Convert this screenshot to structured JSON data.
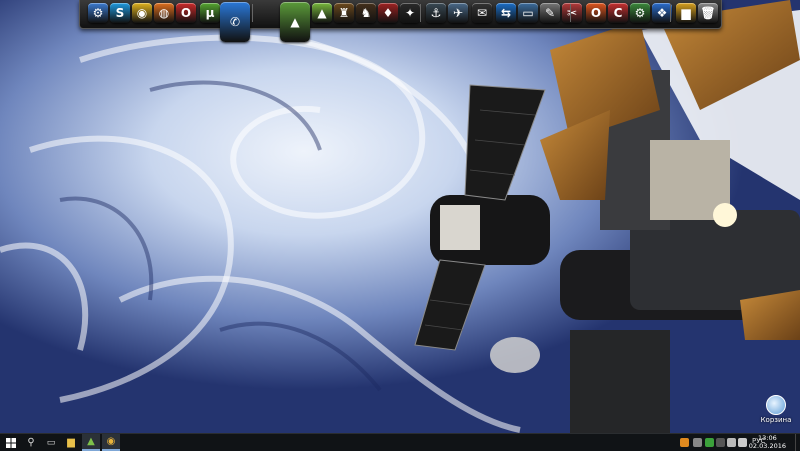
{
  "desktop": {
    "wallpaper": "earth-clouds-space-station",
    "recycle_bin": {
      "icon": "recycle-bin-icon",
      "label": "Корзина"
    }
  },
  "dock": {
    "items": [
      {
        "name": "system-tool-icon",
        "color": "#3b7bd1",
        "glyph": "⚙"
      },
      {
        "name": "skype-icon",
        "color": "#1f9be0",
        "glyph": "S"
      },
      {
        "name": "chrome-icon",
        "color": "#e0b21f",
        "glyph": "◉"
      },
      {
        "name": "firefox-icon",
        "color": "#e0701f",
        "glyph": "◍"
      },
      {
        "name": "opera-icon",
        "color": "#cc2a2a",
        "glyph": "O"
      },
      {
        "name": "utorrent-icon",
        "color": "#55a630",
        "glyph": "µ"
      },
      {
        "name": "phone-call-icon",
        "color": "#2a78d8",
        "glyph": "✆"
      },
      {
        "name": "android-studio-icon",
        "color": "#5b9b3a",
        "glyph": "▲"
      },
      {
        "name": "android-icon",
        "color": "#78b83c",
        "glyph": "▲"
      },
      {
        "name": "game-icon-1",
        "color": "#6d4a1e",
        "glyph": "♜"
      },
      {
        "name": "game-icon-2",
        "color": "#44301c",
        "glyph": "♞"
      },
      {
        "name": "game-icon-3",
        "color": "#a02222",
        "glyph": "♦"
      },
      {
        "name": "game-icon-4",
        "color": "#2a2a2a",
        "glyph": "✦"
      },
      {
        "name": "anchor-icon",
        "color": "#3a4a55",
        "glyph": "⚓"
      },
      {
        "name": "airplane-icon",
        "color": "#4a6a8a",
        "glyph": "✈"
      },
      {
        "name": "mail-icon",
        "color": "#333",
        "glyph": "✉"
      },
      {
        "name": "teamviewer-icon",
        "color": "#1b6fc9",
        "glyph": "⇆"
      },
      {
        "name": "remote-desktop-icon",
        "color": "#3c6d9e",
        "glyph": "▭"
      },
      {
        "name": "feather-icon",
        "color": "#777",
        "glyph": "✎"
      },
      {
        "name": "tool-icon",
        "color": "#b53a3a",
        "glyph": "✂"
      },
      {
        "name": "office-icon",
        "color": "#e0561f",
        "glyph": "O"
      },
      {
        "name": "ccleaner-icon",
        "color": "#c83030",
        "glyph": "C"
      },
      {
        "name": "settings-gear-icon",
        "color": "#3b8a3b",
        "glyph": "⚙"
      },
      {
        "name": "network-icon",
        "color": "#2b6ed0",
        "glyph": "❖"
      },
      {
        "name": "folder-icon",
        "color": "#d9a21f",
        "glyph": "▆"
      },
      {
        "name": "trash-icon",
        "color": "#8a8a8a",
        "glyph": "🗑"
      }
    ]
  },
  "taskbar": {
    "tray_lang": "РУС",
    "clock_time": "13:06",
    "clock_date": "02.03.2016"
  }
}
